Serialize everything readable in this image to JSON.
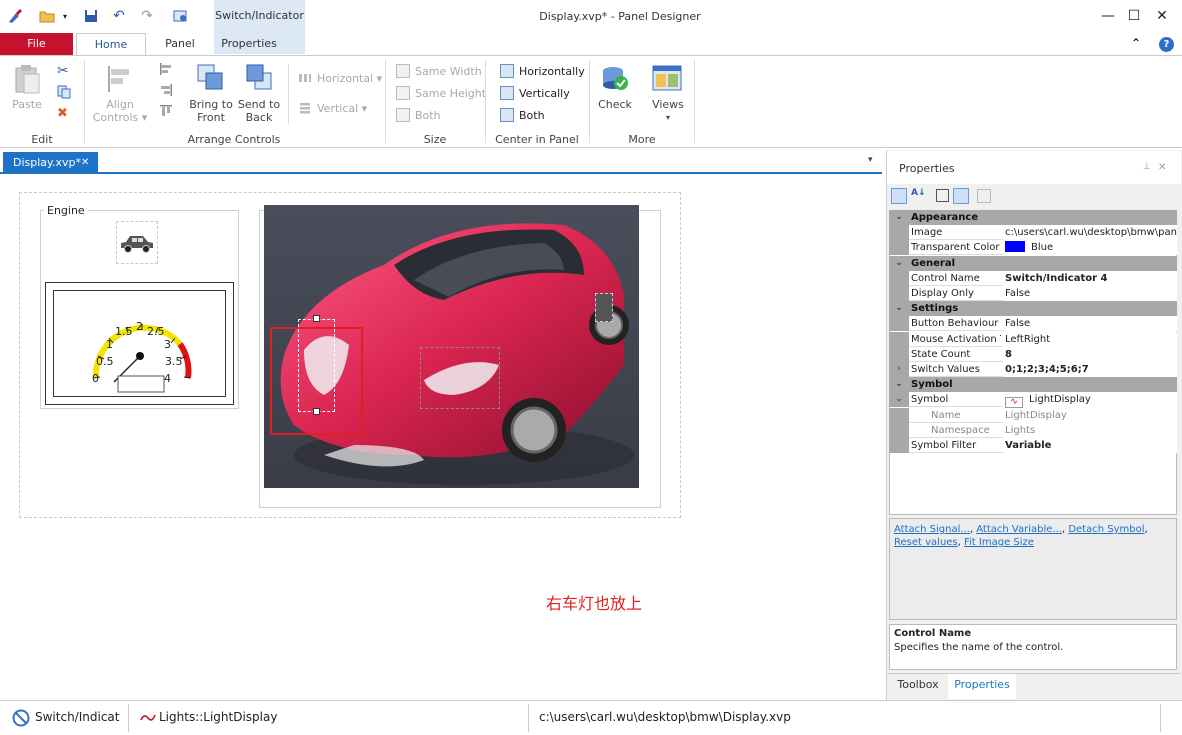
{
  "window": {
    "title": "Display.xvp* - Panel Designer",
    "context_tab_label": "Switch/Indicator",
    "controls": {
      "minimize": "—",
      "maximize": "☐",
      "close": "✕"
    }
  },
  "ribbon": {
    "file_label": "File",
    "tabs": [
      "Home",
      "Panel",
      "Properties"
    ],
    "collapse_glyph": "⌃",
    "help_glyph": "?",
    "groups": {
      "edit": {
        "label": "Edit",
        "paste": "Paste"
      },
      "arrange": {
        "label": "Arrange Controls",
        "align": "Align",
        "align2": "Controls ▾",
        "bring_front_1": "Bring to",
        "bring_front_2": "Front",
        "send_back_1": "Send to",
        "send_back_2": "Back",
        "horizontal": "Horizontal ▾",
        "vertical": "Vertical ▾"
      },
      "size": {
        "label": "Size",
        "same_width": "Same Width",
        "same_height": "Same Height",
        "both": "Both"
      },
      "center": {
        "label": "Center in Panel",
        "horizontally": "Horizontally",
        "vertically": "Vertically",
        "both": "Both"
      },
      "more": {
        "label": "More",
        "check": "Check",
        "views": "Views",
        "views_arrow": "▾"
      }
    }
  },
  "document": {
    "tab_label": "Display.xvp*",
    "tab_close": "✕",
    "dropdown_glyph": "▾",
    "engine_label": "Engine",
    "gauge_ticks": [
      "0",
      "0.5",
      "1",
      "1.5",
      "2",
      "2.5",
      "3",
      "3.5",
      "4"
    ],
    "annotation": "右车灯也放上"
  },
  "properties": {
    "title": "Properties",
    "pin_glyph": "⊥",
    "close_glyph": "✕",
    "rows": [
      {
        "kind": "cat",
        "name": "Appearance"
      },
      {
        "kind": "prop",
        "name": "Image",
        "value": "c:\\users\\carl.wu\\desktop\\bmw\\panel\\B"
      },
      {
        "kind": "prop",
        "name": "Transparent Color",
        "value": "Blue",
        "swatch": "#0000ff"
      },
      {
        "kind": "cat",
        "name": "General"
      },
      {
        "kind": "prop",
        "name": "Control Name",
        "value": "Switch/Indicator 4",
        "bold": true
      },
      {
        "kind": "prop",
        "name": "Display Only",
        "value": "False"
      },
      {
        "kind": "cat",
        "name": "Settings"
      },
      {
        "kind": "prop",
        "name": "Button Behaviour",
        "value": "False"
      },
      {
        "kind": "prop",
        "name": "Mouse Activation T",
        "value": "LeftRight"
      },
      {
        "kind": "prop",
        "name": "State Count",
        "value": "8",
        "bold": true
      },
      {
        "kind": "prop",
        "name": "Switch Values",
        "value": "0;1;2;3;4;5;6;7",
        "bold": true,
        "expander": "›"
      },
      {
        "kind": "cat",
        "name": "Symbol"
      },
      {
        "kind": "prop",
        "name": "Symbol",
        "value": "LightDisplay",
        "expander": "⌄",
        "icon": true
      },
      {
        "kind": "sub",
        "name": "Name",
        "value": "LightDisplay"
      },
      {
        "kind": "sub",
        "name": "Namespace",
        "value": "Lights"
      },
      {
        "kind": "prop",
        "name": "Symbol Filter",
        "value": "Variable",
        "bold": true
      }
    ],
    "actions": [
      "Attach Signal...",
      "Attach Variable...",
      "Detach Symbol",
      "Reset values",
      "Fit Image Size"
    ],
    "help_title": "Control Name",
    "help_text": "Specifies the name of the control.",
    "bottom_tabs": [
      "Toolbox",
      "Properties"
    ]
  },
  "statusbar": {
    "item1": "Switch/Indicato",
    "item2": "Lights::LightDisplay",
    "path": "c:\\users\\carl.wu\\desktop\\bmw\\Display.xvp"
  },
  "colors": {
    "accent": "#1e73c8",
    "file_tab": "#c4122f",
    "selection": "#e02020",
    "car_body": "#d92550"
  }
}
